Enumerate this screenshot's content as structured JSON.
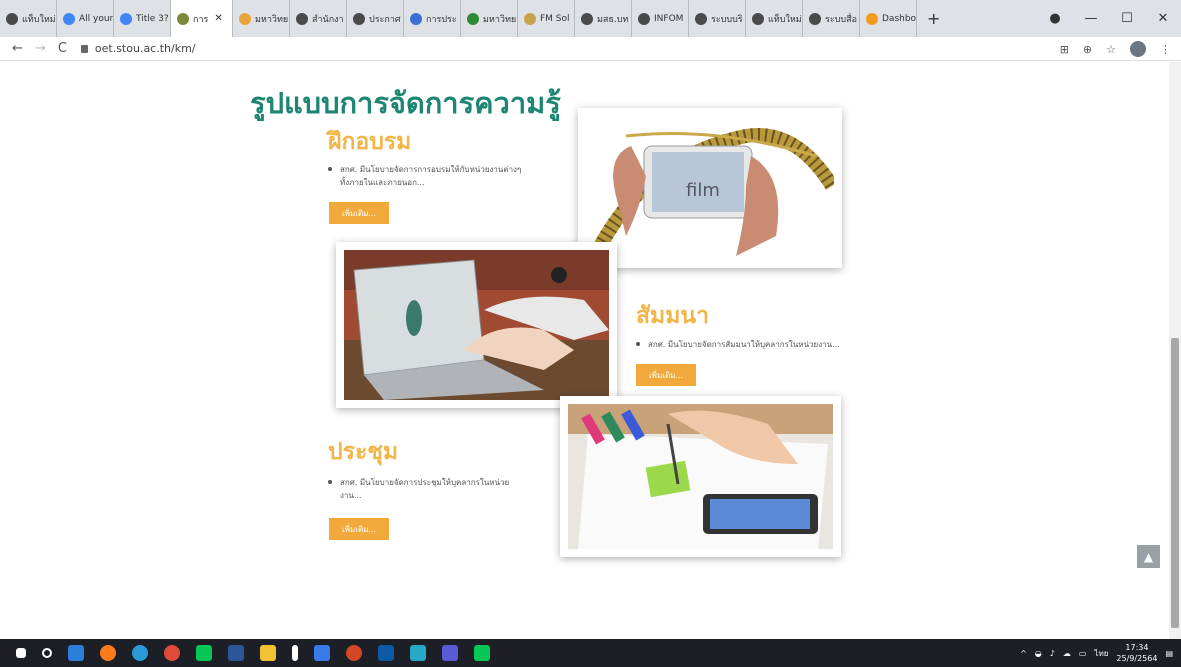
{
  "browser": {
    "tabs": [
      {
        "label": "แท็บใหม่",
        "color": "#4a4a4a"
      },
      {
        "label": "All your",
        "color": "#4285f4"
      },
      {
        "label": "Title 3?",
        "color": "#4285f4"
      },
      {
        "label": "การ",
        "color": "#7a8a3a",
        "active": true
      },
      {
        "label": "มหาวิทย",
        "color": "#e8a33a"
      },
      {
        "label": "สำนักงา",
        "color": "#4a4a4a"
      },
      {
        "label": "ประกาศ",
        "color": "#4a4a4a"
      },
      {
        "label": "การประ",
        "color": "#3b6fd6"
      },
      {
        "label": "มหาวิทย",
        "color": "#2e8b3a"
      },
      {
        "label": "FM Sol",
        "color": "#c8a24a"
      },
      {
        "label": "มสธ.บท",
        "color": "#4a4a4a"
      },
      {
        "label": "INFOM",
        "color": "#4a4a4a"
      },
      {
        "label": "ระบบบริ",
        "color": "#4a4a4a"
      },
      {
        "label": "แท็บใหม่",
        "color": "#4a4a4a"
      },
      {
        "label": "ระบบสื่อ",
        "color": "#4a4a4a"
      },
      {
        "label": "Dashbo",
        "color": "#f29b1e"
      }
    ],
    "new_tab_label": "+",
    "url": "oet.stou.ac.th/km/"
  },
  "page": {
    "heading": "รูปแบบการจัดการความรู้",
    "sections": [
      {
        "title": "ฝึกอบรม",
        "bullet": "สกศ. มีนโยบายจัดการการอบรมให้กับหน่วยงานต่างๆ ทั้งภายในและภายนอก...",
        "button": "เพิ่มเติม..."
      },
      {
        "title": "สัมมนา",
        "bullet": "สกศ. มีนโยบายจัดการสัมมนาให้บุคลากรในหน่วยงาน...",
        "button": "เพิ่มเติม..."
      },
      {
        "title": "ประชุม",
        "bullet": "สกศ. มีนโยบายจัดการประชุมให้บุคลากรในหน่วยงาน...",
        "button": "เพิ่มเติม..."
      }
    ],
    "film_word": "film",
    "back_to_top": "▲"
  },
  "taskbar": {
    "lang": "ไทย",
    "time": "17:34",
    "date": "25/9/2564"
  }
}
